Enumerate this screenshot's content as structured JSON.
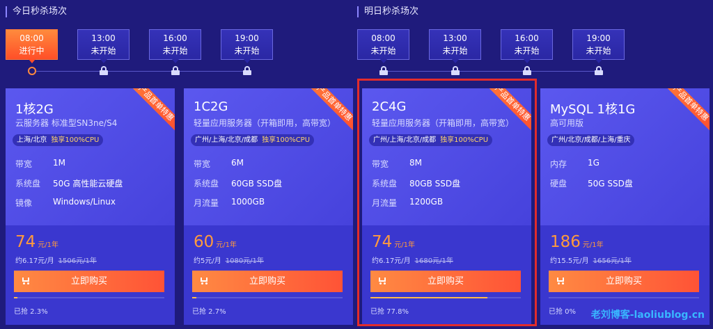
{
  "sections": [
    {
      "title": "今日秒杀场次",
      "slots": [
        {
          "time": "08:00",
          "status": "进行中",
          "active": true
        },
        {
          "time": "13:00",
          "status": "未开始",
          "active": false
        },
        {
          "time": "16:00",
          "status": "未开始",
          "active": false
        },
        {
          "time": "19:00",
          "status": "未开始",
          "active": false
        }
      ]
    },
    {
      "title": "明日秒杀场次",
      "slots": [
        {
          "time": "08:00",
          "status": "未开始",
          "active": false
        },
        {
          "time": "13:00",
          "status": "未开始",
          "active": false
        },
        {
          "time": "16:00",
          "status": "未开始",
          "active": false
        },
        {
          "time": "19:00",
          "status": "未开始",
          "active": false
        }
      ]
    }
  ],
  "products": [
    {
      "ribbon": "产品首单特惠",
      "name": "1核2G",
      "desc": "云服务器 标准型SN3ne/S4",
      "region": "上海/北京",
      "cpu": "独享100%CPU",
      "specs": [
        {
          "k": "带宽",
          "v": "1M"
        },
        {
          "k": "系统盘",
          "v": "50G 高性能云硬盘"
        },
        {
          "k": "镜像",
          "v": "Windows/Linux"
        }
      ],
      "price": "74",
      "unit": "元/1年",
      "monthly": "约6.17元/月",
      "original": "1506元/1年",
      "buy": "立即购买",
      "progress": 0.023,
      "sold": "已抢 2.3%"
    },
    {
      "ribbon": "产品首单特惠",
      "name": "1C2G",
      "desc": "轻量应用服务器（开箱即用，高带宽）",
      "region": "广州/上海/北京/成都",
      "cpu": "独享100%CPU",
      "specs": [
        {
          "k": "带宽",
          "v": "6M"
        },
        {
          "k": "系统盘",
          "v": "60GB SSD盘"
        },
        {
          "k": "月流量",
          "v": "1000GB"
        }
      ],
      "price": "60",
      "unit": "元/1年",
      "monthly": "约5元/月",
      "original": "1080元/1年",
      "buy": "立即购买",
      "progress": 0.027,
      "sold": "已抢 2.7%"
    },
    {
      "ribbon": "产品首单特惠",
      "name": "2C4G",
      "desc": "轻量应用服务器（开箱即用，高带宽）",
      "region": "广州/上海/北京/成都",
      "cpu": "独享100%CPU",
      "specs": [
        {
          "k": "带宽",
          "v": "8M"
        },
        {
          "k": "系统盘",
          "v": "80GB SSD盘"
        },
        {
          "k": "月流量",
          "v": "1200GB"
        }
      ],
      "price": "74",
      "unit": "元/1年",
      "monthly": "约6.17元/月",
      "original": "1680元/1年",
      "buy": "立即购买",
      "progress": 0.778,
      "sold": "已抢 77.8%"
    },
    {
      "ribbon": "产品首单特惠",
      "name": "MySQL 1核1G",
      "desc": "高可用版",
      "region": "广州/北京/成都/上海/重庆",
      "cpu": "",
      "specs": [
        {
          "k": "内存",
          "v": "1G"
        },
        {
          "k": "硬盘",
          "v": "50G SSD盘"
        }
      ],
      "price": "186",
      "unit": "元/1年",
      "monthly": "约15.5元/月",
      "original": "1656元/1年",
      "buy": "立即购买",
      "progress": 0,
      "sold": "已抢 0%"
    }
  ],
  "watermark": "老刘博客-laoliublog.cn",
  "colors": {
    "background": "#1f1b7c",
    "accent": "#ff5336",
    "price": "#ff9a3d",
    "highlight": "#e22c2c"
  }
}
